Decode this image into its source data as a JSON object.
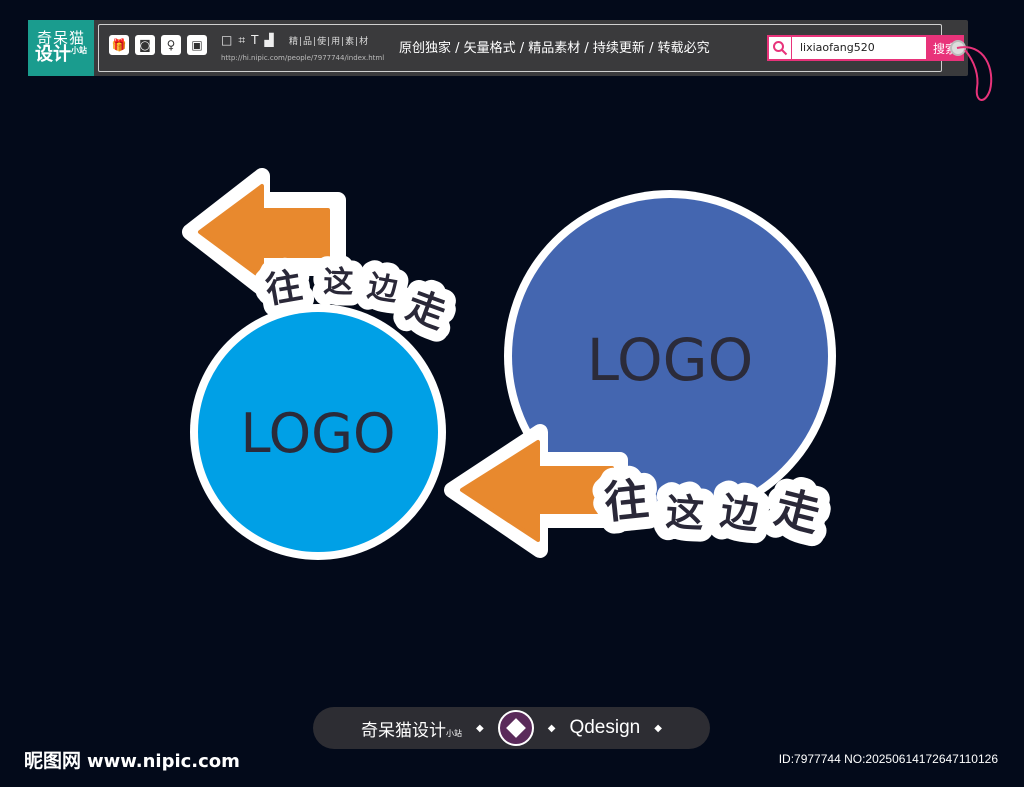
{
  "banner": {
    "brand_line1": "奇呆猫",
    "brand_line2": "设计",
    "brand_small": "小站",
    "tool_icons": [
      "gift-icon",
      "camera-icon",
      "dress-icon",
      "backpack-icon"
    ],
    "tiny_icons": [
      "□",
      "⌗",
      "T",
      "▟"
    ],
    "categories": "精|品|使|用|素|材",
    "url": "http://hi.nipic.com/people/7977744/index.html",
    "slogan": "原创独家 / 矢量格式 / 精品素材 / 持续更新 / 转载必究",
    "search_value": "lixiaofang520",
    "search_button": "搜索",
    "accent_color": "#e8337a",
    "brand_color": "#1a9c8e"
  },
  "stickers": {
    "left_logo": "LOGO",
    "right_logo": "LOGO",
    "left_cta": [
      "往",
      "这",
      "边",
      "走"
    ],
    "right_cta": [
      "往",
      "这",
      "边",
      "走"
    ],
    "left_circle_color": "#00a0e6",
    "right_circle_color": "#4466b0",
    "arrow_color": "#e8892e"
  },
  "footer": {
    "brand": "奇呆猫设计",
    "brand_small": "小站",
    "q_label": "Qdesign",
    "site_name": "昵图网",
    "site_url": "www.nipic.com",
    "image_id": "ID:7977744 NO:20250614172647110126"
  }
}
